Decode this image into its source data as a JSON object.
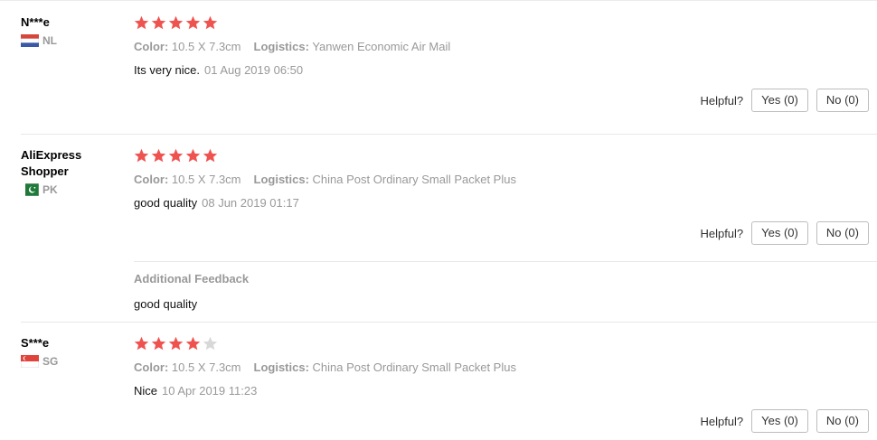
{
  "colors": {
    "star_filled": "#ef5350",
    "star_empty": "#d8d8d8"
  },
  "labels": {
    "color_label": "Color:",
    "logistics_label": "Logistics:",
    "helpful": "Helpful?",
    "additional_feedback": "Additional Feedback"
  },
  "reviews": [
    {
      "name": "N***e",
      "country": "NL",
      "flag": "netherlands-flag-icon",
      "rating": 5,
      "max_rating": 5,
      "color": "10.5 X 7.3cm",
      "logistics": "Yanwen Economic Air Mail",
      "text": "Its very nice.",
      "date": "01 Aug 2019 06:50",
      "yes": "Yes (0)",
      "no": "No (0)"
    },
    {
      "name": "AliExpress Shopper",
      "country": "PK",
      "flag": "pakistan-flag-icon",
      "rating": 5,
      "max_rating": 5,
      "color": "10.5 X 7.3cm",
      "logistics": "China Post Ordinary Small Packet Plus",
      "text": "good quality",
      "date": "08 Jun 2019 01:17",
      "yes": "Yes (0)",
      "no": "No (0)",
      "additional_feedback": "good quality"
    },
    {
      "name": "S***e",
      "country": "SG",
      "flag": "singapore-flag-icon",
      "rating": 4,
      "max_rating": 5,
      "color": "10.5 X 7.3cm",
      "logistics": "China Post Ordinary Small Packet Plus",
      "text": "Nice",
      "date": "10 Apr 2019 11:23",
      "yes": "Yes (0)",
      "no": "No (0)"
    }
  ]
}
